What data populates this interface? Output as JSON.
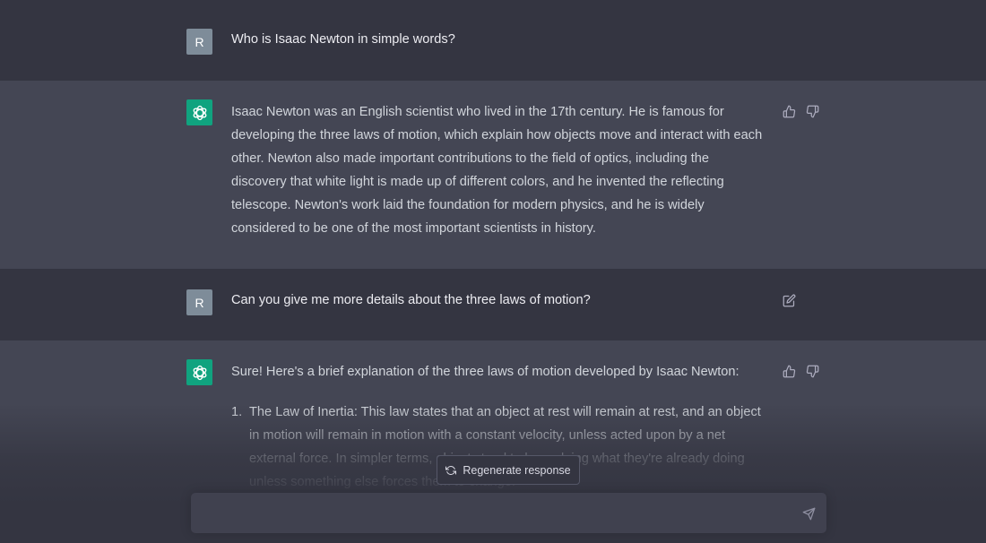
{
  "conversation": {
    "messages": [
      {
        "role": "user",
        "avatar_letter": "R",
        "text": "Who is Isaac Newton in simple words?"
      },
      {
        "role": "assistant",
        "avatar_icon": "chatgpt-logo-icon",
        "lines": [
          "Isaac Newton was an English scientist who lived in the 17th century. He is famous for",
          "developing the three laws of motion, which explain how objects move and interact with each",
          "other. Newton also made important contributions to the field of optics, including the",
          "discovery that white light is made up of different colors, and he invented the reflecting",
          "telescope. Newton's work laid the foundation for modern physics, and he is widely",
          "considered to be one of the most important scientists in history."
        ]
      },
      {
        "role": "user",
        "avatar_letter": "R",
        "text": "Can you give me more details about the three laws of motion?"
      },
      {
        "role": "assistant",
        "avatar_icon": "chatgpt-logo-icon",
        "intro": "Sure! Here's a brief explanation of the three laws of motion developed by Isaac Newton:",
        "list_number": "1.",
        "list_lines": [
          "The Law of Inertia: This law states that an object at rest will remain at rest, and an object",
          "in motion will remain in motion with a constant velocity, unless acted upon by a net",
          "external force. In simpler terms, objects tend to keep doing what they're already doing",
          "unless something else forces them to change."
        ]
      }
    ]
  },
  "controls": {
    "regenerate_label": "Regenerate response",
    "composer_placeholder": ""
  },
  "colors": {
    "user_bg": "#343541",
    "assistant_bg": "#444654",
    "avatar_user": "#7e8c99",
    "avatar_bot": "#10a37f"
  }
}
